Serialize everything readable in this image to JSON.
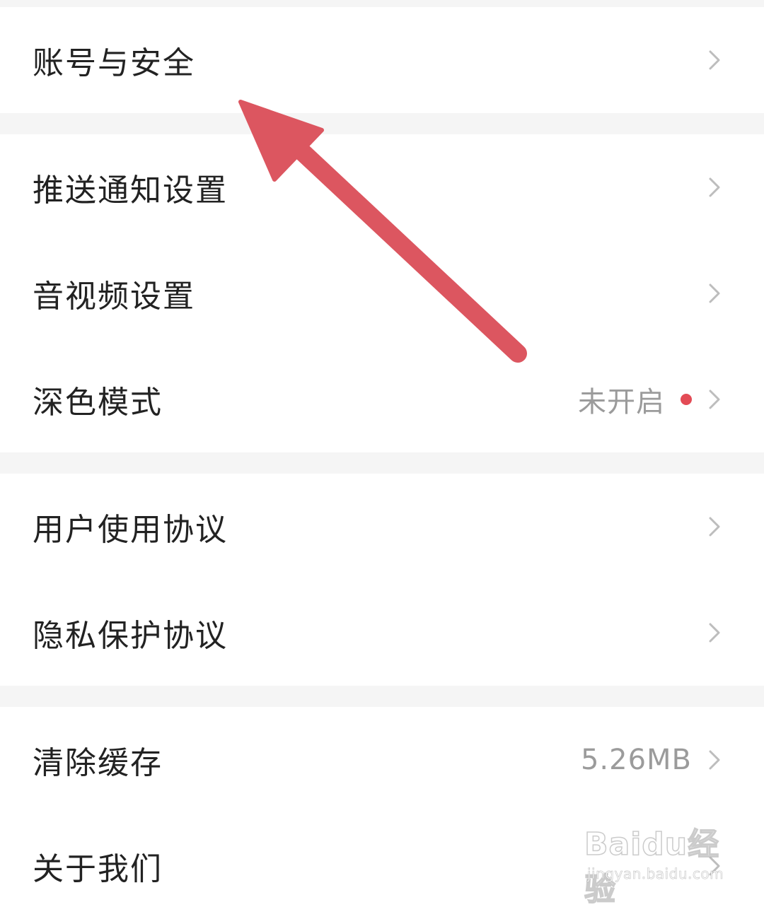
{
  "settings": {
    "rows": [
      {
        "label": "账号与安全"
      },
      {
        "label": "推送通知设置"
      },
      {
        "label": "音视频设置"
      },
      {
        "label": "深色模式",
        "value": "未开启",
        "has_dot": true
      },
      {
        "label": "用户使用协议"
      },
      {
        "label": "隐私保护协议"
      },
      {
        "label": "清除缓存",
        "value": "5.26MB"
      },
      {
        "label": "关于我们"
      }
    ]
  },
  "watermark": {
    "brand": "Baidu经验",
    "url": "jingyan.baidu.com"
  },
  "colors": {
    "background": "#f5f5f5",
    "row_bg": "#ffffff",
    "label_text": "#222222",
    "value_text": "#9b9b9b",
    "dot": "#e34b55",
    "chevron": "#bdbdbd",
    "annotation_arrow": "#dc5660"
  },
  "icons": {
    "chevron": "chevron-right-icon",
    "annotation": "annotation-arrow"
  }
}
